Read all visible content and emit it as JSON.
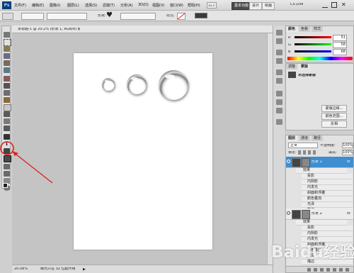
{
  "app": {
    "logo": "Ps",
    "zoom_combo": "33.3"
  },
  "menu": [
    "文件(F)",
    "编辑(E)",
    "图像(I)",
    "图层(L)",
    "选择(S)",
    "滤镜(T)",
    "分析(A)",
    "3D(D)",
    "视图(V)",
    "窗口(W)",
    "帮助(H)"
  ],
  "workspace_buttons": [
    "基本功能",
    "设计",
    "绘画"
  ],
  "cs_live": "CS Live",
  "options_bar": {
    "mode_label": "形状:",
    "style_label": "样式:"
  },
  "document": {
    "tab_title": "未标题-1 @ 20.2% (形状 1, RGB/8) *",
    "zoom_status": "20.08%",
    "doc_status": "曝光只在 32 位起作用"
  },
  "color_panel": {
    "tabs": [
      "颜色",
      "色板",
      "样式"
    ],
    "channels": [
      {
        "label": "R",
        "value": "51"
      },
      {
        "label": "G",
        "value": "58"
      },
      {
        "label": "B",
        "value": "68"
      }
    ]
  },
  "adjust_panel": {
    "tabs": [
      "调整",
      "蒙版"
    ],
    "subtitle": "未选择蒙版",
    "buttons": [
      "蒙版边缘...",
      "颜色范围...",
      "反相"
    ]
  },
  "layers_panel": {
    "tabs": [
      "图层",
      "通道",
      "路径"
    ],
    "blend_mode": "正常",
    "opacity_label": "不透明度:",
    "opacity_value": "100%",
    "lock_label": "锁定:",
    "fill_label": "填充:",
    "fill_value": "100%",
    "layers": [
      {
        "name": "形状 1",
        "selected": true
      },
      {
        "name": "形状 2",
        "selected": false
      }
    ],
    "effects_label": "效果",
    "fx_group1": [
      "投影",
      "内阴影",
      "内发光",
      "斜面和浮雕",
      "颜色叠加",
      "光泽",
      "描边"
    ],
    "fx_group2": [
      "投影",
      "内阴影",
      "内发光",
      "斜面和浮雕",
      "颜色叠加",
      "光泽",
      "描边"
    ]
  },
  "watermark": "Baidu经验",
  "colors": {
    "selection_blue": "#3e8ed0",
    "annotation_red": "#e0201c",
    "dark_workspace": "#4b4b4b"
  }
}
